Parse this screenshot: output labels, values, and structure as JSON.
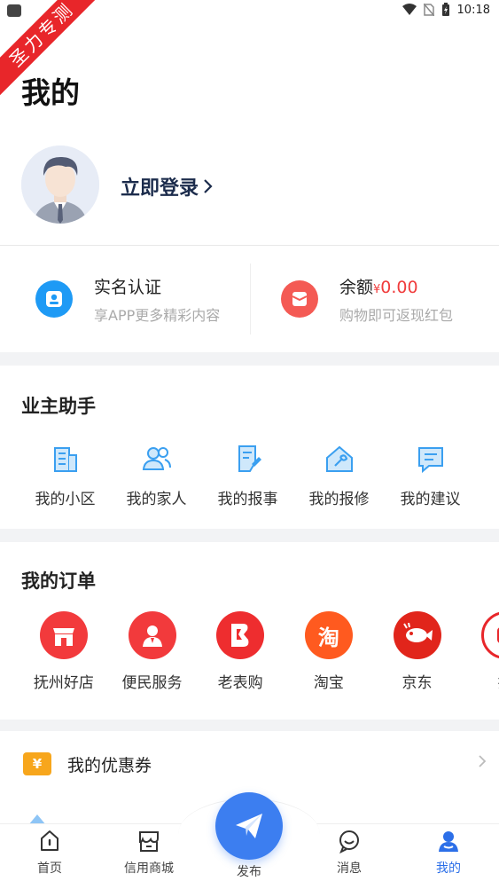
{
  "status_bar": {
    "time": "10:18"
  },
  "watermark": "圣力专测",
  "page_title": "我的",
  "profile": {
    "login_label": "立即登录"
  },
  "quick_actions": {
    "verify": {
      "title": "实名认证",
      "subtitle": "享APP更多精彩内容"
    },
    "balance": {
      "title": "余额",
      "currency": "¥",
      "amount": "0.00",
      "subtitle": "购物即可返现红包"
    }
  },
  "owner_assistant": {
    "title": "业主助手",
    "items": [
      {
        "label": "我的小区",
        "icon": "building-icon"
      },
      {
        "label": "我的家人",
        "icon": "people-icon"
      },
      {
        "label": "我的报事",
        "icon": "report-icon"
      },
      {
        "label": "我的报修",
        "icon": "repair-icon"
      },
      {
        "label": "我的建议",
        "icon": "suggestion-icon"
      }
    ]
  },
  "orders": {
    "title": "我的订单",
    "items": [
      {
        "label": "抚州好店",
        "icon": "shop-icon",
        "color": "#f23a3c"
      },
      {
        "label": "便民服务",
        "icon": "service-icon",
        "color": "#f23a3c"
      },
      {
        "label": "老表购",
        "icon": "b-logo-icon",
        "color": "#ee2d2f"
      },
      {
        "label": "淘宝",
        "icon": "taobao-icon",
        "color": "#ff5a1f"
      },
      {
        "label": "京东",
        "icon": "jd-icon",
        "color": "#e1251b"
      },
      {
        "label": "拼",
        "icon": "pdd-icon",
        "color": "#e8262a"
      }
    ]
  },
  "coupon": {
    "label": "我的优惠券",
    "icon_text": "¥"
  },
  "tabs": [
    {
      "label": "首页",
      "icon": "home-icon"
    },
    {
      "label": "信用商城",
      "icon": "store-icon"
    },
    {
      "label": "发布",
      "icon": "paper-plane-icon"
    },
    {
      "label": "消息",
      "icon": "message-icon"
    },
    {
      "label": "我的",
      "icon": "user-icon"
    }
  ],
  "colors": {
    "accent": "#2c6fe8",
    "price": "#f03c3c",
    "ribbon": "#e8262a"
  }
}
